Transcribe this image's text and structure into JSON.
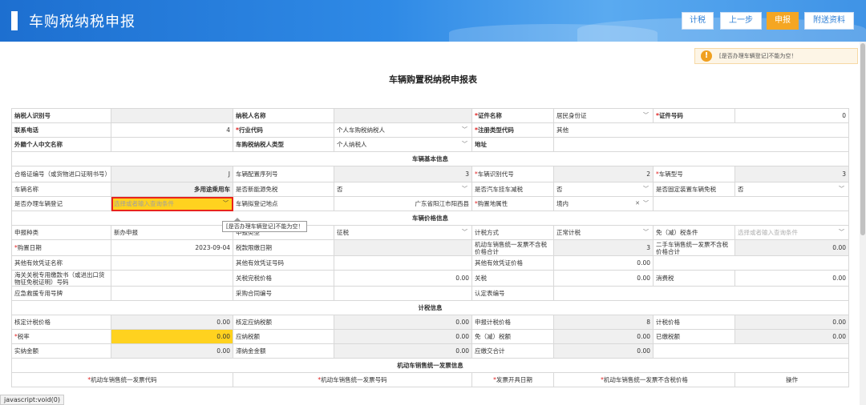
{
  "header": {
    "title": "车购税纳税申报",
    "buttons": {
      "calc": "计税",
      "prev": "上一步",
      "submit": "申报",
      "attach": "附送资料"
    },
    "colors": {
      "accent": "#2f8ae6",
      "primary_button": "#f5a623"
    }
  },
  "alert": {
    "icon": "!",
    "text": "[是否办理车辆登记]不能为空！"
  },
  "form_title": "车辆购置税纳税申报表",
  "taxpayer": {
    "id_label": "纳税人识别号",
    "id_value": "",
    "name_label": "纳税人名称",
    "name_value": "",
    "cert_name_label": "证件名称",
    "cert_name_value": "居民身份证",
    "cert_no_label": "证件号码",
    "cert_no_value": "0",
    "phone_label": "联系电话",
    "phone_value": "4",
    "industry_label": "行业代码",
    "industry_value": "个人车购税纳税人",
    "reg_type_label": "注册类型代码",
    "reg_type_value": "其他",
    "foreign_name_label": "外籍个人中文名称",
    "foreign_name_value": "",
    "taxpayer_type_label": "车购税纳税人类型",
    "taxpayer_type_value": "个人纳税人",
    "address_label": "地址",
    "address_value": ""
  },
  "vehicle": {
    "section": "车辆基本信息",
    "cert_label": "合格证编号（或货物进口证明书号）",
    "cert_value": "J",
    "config_label": "车辆配置序列号",
    "config_value": "3",
    "vin_label": "车辆识别代号",
    "vin_value": "2",
    "model_label": "车辆型号",
    "model_value": "3",
    "name_label": "车辆名称",
    "name_value": "多用途乘用车",
    "new_energy_label": "是否新能源免税",
    "new_energy_value": "否",
    "trailer_label": "是否汽车挂车减税",
    "trailer_value": "否",
    "fixed_label": "是否固定装置车辆免税",
    "fixed_value": "否",
    "register_label": "是否办理车辆登记",
    "register_placeholder": "选择或者输入查询条件",
    "reg_place_label": "车辆拟登记地点",
    "reg_place_value": "广东省阳江市阳西县",
    "purchase_attr_label": "购置地属性",
    "purchase_attr_value": "境内",
    "tooltip": "[是否办理车辆登记]不能为空！"
  },
  "price": {
    "section": "车辆价格信息",
    "apply_type_label": "申报种类",
    "apply_type_value": "新办申报",
    "apply_class_label": "申报类型",
    "apply_class_value": "征税",
    "method_label": "计税方式",
    "method_value": "正常计税",
    "exempt_label": "免（减）税条件",
    "exempt_placeholder": "选择或者输入查询条件",
    "purchase_date_label": "购置日期",
    "purchase_date_value": "2023-09-04",
    "deadline_label": "税款限缴日期",
    "deadline_value": "",
    "invoice_total_label": "机动车销售统一发票不含税价格合计",
    "invoice_total_value": "3",
    "used_car_label": "二手车销售统一发票不含税价格合计",
    "used_car_value": "0.00",
    "other_cert_label": "其他有效凭证名称",
    "other_cert_value": "",
    "other_cert_no_label": "其他有效凭证号码",
    "other_cert_no_value": "",
    "other_price_label": "其他有效凭证价格",
    "other_price_value": "0.00",
    "customs_label": "海关关税专用缴款书（或进出口货物征免税证明）号码",
    "customs_value": "",
    "customs_price_label": "关税完税价格",
    "customs_price_value": "0.00",
    "tariff_label": "关税",
    "tariff_value": "0.00",
    "consumption_label": "消费税",
    "consumption_value": "0.00",
    "rescue_label": "应急救援专用号牌",
    "rescue_value": "",
    "contract_label": "采购合同编号",
    "contract_value": "",
    "cert_table_label": "认定表编号",
    "cert_table_value": ""
  },
  "tax": {
    "section": "计税信息",
    "verified_price_label": "核定计税价格",
    "verified_price_value": "0.00",
    "verified_due_label": "核定应纳税额",
    "verified_due_value": "0.00",
    "declared_price_label": "申报计税价格",
    "declared_price_value": "8",
    "taxable_price_label": "计税价格",
    "taxable_price_value": "0.00",
    "rate_label": "税率",
    "rate_value": "0.00",
    "payable_label": "应纳税额",
    "payable_value": "0.00",
    "exempt_amount_label": "免（减）税额",
    "exempt_amount_value": "0.00",
    "paid_label": "已缴税额",
    "paid_value": "0.00",
    "actual_label": "实纳金额",
    "actual_value": "0.00",
    "late_fee_label": "滞纳金金额",
    "late_fee_value": "0.00",
    "total_label": "应缴交合计",
    "total_value": "0.00"
  },
  "invoice": {
    "section": "机动车销售统一发票信息",
    "columns": [
      "机动车销售统一发票代码",
      "机动车销售统一发票号码",
      "发票开具日期",
      "机动车销售统一发票不含税价格",
      "操作"
    ]
  },
  "statusbar": "javascript:void(0)"
}
